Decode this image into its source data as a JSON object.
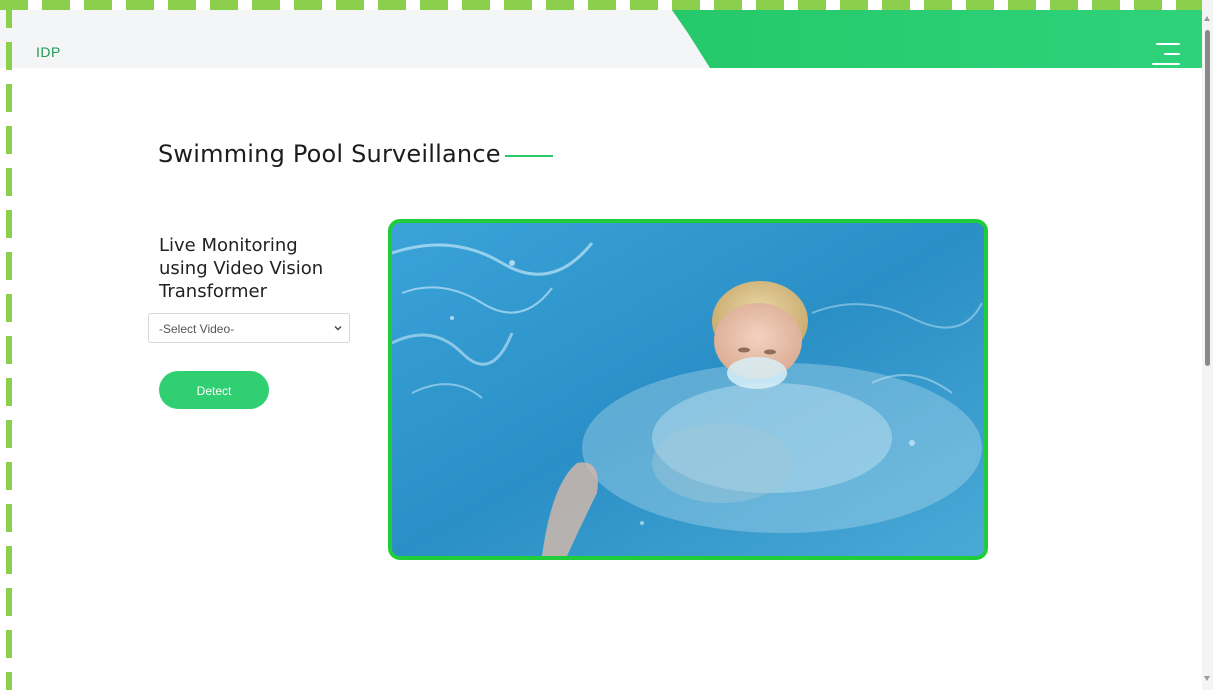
{
  "header": {
    "brand": "IDP",
    "menu_icon": "hamburger-menu-icon"
  },
  "main": {
    "title": "Swimming Pool Surveillance",
    "subheading": "Live Monitoring using Video Vision Transformer",
    "select": {
      "selected": "-Select Video-"
    },
    "detect_label": "Detect",
    "video_icon": "video-frame"
  },
  "colors": {
    "accent": "#25c96a",
    "video_border": "#1fcd3b",
    "frame_dash": "#8ccf4d"
  }
}
